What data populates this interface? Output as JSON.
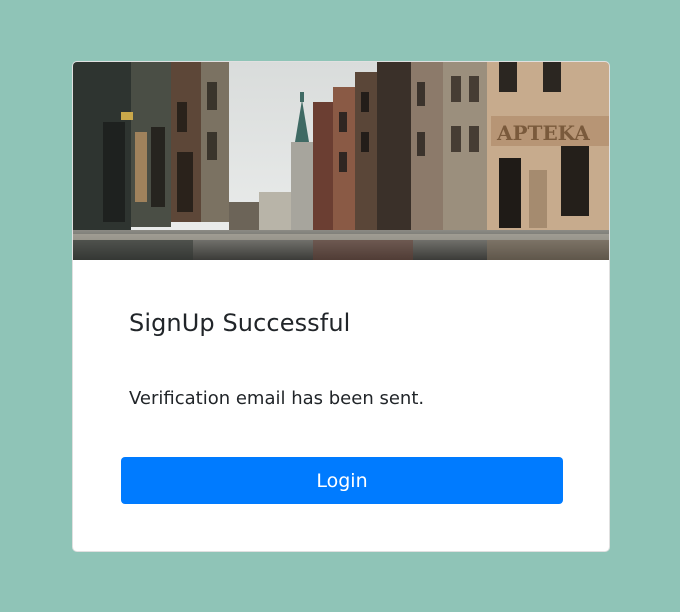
{
  "card": {
    "hero_image": "city-street-photo",
    "title": "SignUp Successful",
    "message": "Verification email has been sent.",
    "login_label": "Login"
  },
  "colors": {
    "page_background": "#8fc4b7",
    "card_background": "#ffffff",
    "primary_button": "#007bff",
    "text": "#212529"
  }
}
